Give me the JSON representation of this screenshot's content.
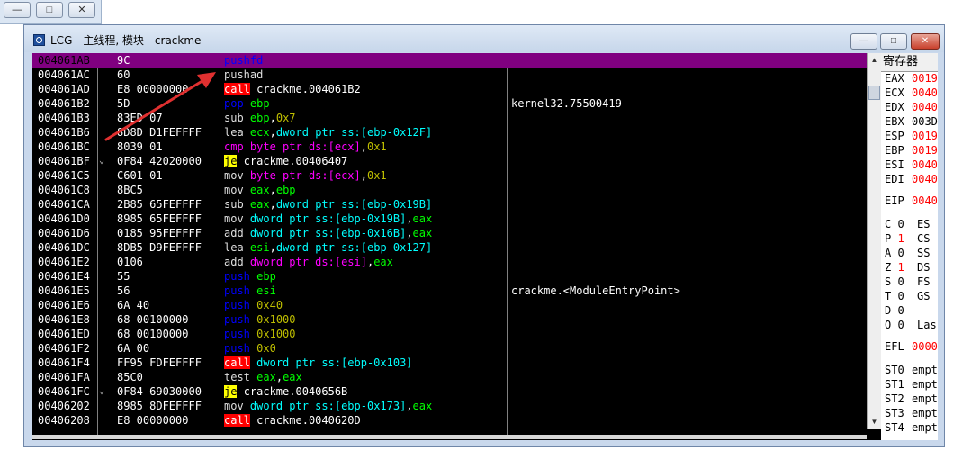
{
  "window": {
    "title": "LCG -  主线程, 模块 - crackme",
    "min_label": "—",
    "max_label": "□",
    "close_label": "✕"
  },
  "background_window": {
    "min_label": "—",
    "max_label": "□",
    "close_label": "✕"
  },
  "disassembly": {
    "selected_index": 0,
    "rows": [
      {
        "addr": "004061AB",
        "mark": "",
        "hex": "9C",
        "mn": "pushfd",
        "mc": "m-push",
        "ops": [],
        "com": ""
      },
      {
        "addr": "004061AC",
        "mark": "",
        "hex": "60",
        "mn": "pushad",
        "mc": "m-pushad",
        "ops": [],
        "com": ""
      },
      {
        "addr": "004061AD",
        "mark": "",
        "hex": "E8 00000000",
        "mn": "call",
        "mc": "m-call",
        "ops": [
          {
            "t": "crackme.004061B2",
            "c": "op-sym"
          }
        ],
        "com": ""
      },
      {
        "addr": "004061B2",
        "mark": "",
        "hex": "5D",
        "mn": "pop",
        "mc": "m-pop",
        "ops": [
          {
            "t": "ebp",
            "c": "op-reg"
          }
        ],
        "com": "kernel32.75500419"
      },
      {
        "addr": "004061B3",
        "mark": "",
        "hex": "83ED 07",
        "mn": "sub",
        "mc": "m-sub",
        "ops": [
          {
            "t": "ebp",
            "c": "op-reg"
          },
          {
            "t": ",",
            "c": "op-sym"
          },
          {
            "t": "0x7",
            "c": "op-num"
          }
        ],
        "com": ""
      },
      {
        "addr": "004061B6",
        "mark": "",
        "hex": "8D8D D1FEFFFF",
        "mn": "lea",
        "mc": "m-lea",
        "ops": [
          {
            "t": "ecx",
            "c": "op-reg"
          },
          {
            "t": ",",
            "c": "op-sym"
          },
          {
            "t": "dword ptr ss:[ebp-0x12F]",
            "c": "op-mem"
          }
        ],
        "com": ""
      },
      {
        "addr": "004061BC",
        "mark": "",
        "hex": "8039 01",
        "mn": "cmp",
        "mc": "m-cmp",
        "ops": [
          {
            "t": "byte ptr ds:[ecx]",
            "c": "op-kw"
          },
          {
            "t": ",",
            "c": "op-sym"
          },
          {
            "t": "0x1",
            "c": "op-num"
          }
        ],
        "com": ""
      },
      {
        "addr": "004061BF",
        "mark": "⌄",
        "hex": "0F84 42020000",
        "mn": "je",
        "mc": "m-jmp",
        "ops": [
          {
            "t": "crackme.00406407",
            "c": "op-sym"
          }
        ],
        "com": ""
      },
      {
        "addr": "004061C5",
        "mark": "",
        "hex": "C601 01",
        "mn": "mov",
        "mc": "m-mov",
        "ops": [
          {
            "t": "byte ptr ds:[ecx]",
            "c": "op-kw"
          },
          {
            "t": ",",
            "c": "op-sym"
          },
          {
            "t": "0x1",
            "c": "op-num"
          }
        ],
        "com": ""
      },
      {
        "addr": "004061C8",
        "mark": "",
        "hex": "8BC5",
        "mn": "mov",
        "mc": "m-mov",
        "ops": [
          {
            "t": "eax",
            "c": "op-reg"
          },
          {
            "t": ",",
            "c": "op-sym"
          },
          {
            "t": "ebp",
            "c": "op-reg"
          }
        ],
        "com": ""
      },
      {
        "addr": "004061CA",
        "mark": "",
        "hex": "2B85 65FEFFFF",
        "mn": "sub",
        "mc": "m-sub",
        "ops": [
          {
            "t": "eax",
            "c": "op-reg"
          },
          {
            "t": ",",
            "c": "op-sym"
          },
          {
            "t": "dword ptr ss:[ebp-0x19B]",
            "c": "op-mem"
          }
        ],
        "com": ""
      },
      {
        "addr": "004061D0",
        "mark": "",
        "hex": "8985 65FEFFFF",
        "mn": "mov",
        "mc": "m-mov",
        "ops": [
          {
            "t": "dword ptr ss:[ebp-0x19B]",
            "c": "op-mem"
          },
          {
            "t": ",",
            "c": "op-sym"
          },
          {
            "t": "eax",
            "c": "op-reg"
          }
        ],
        "com": ""
      },
      {
        "addr": "004061D6",
        "mark": "",
        "hex": "0185 95FEFFFF",
        "mn": "add",
        "mc": "m-add",
        "ops": [
          {
            "t": "dword ptr ss:[ebp-0x16B]",
            "c": "op-mem"
          },
          {
            "t": ",",
            "c": "op-sym"
          },
          {
            "t": "eax",
            "c": "op-reg"
          }
        ],
        "com": ""
      },
      {
        "addr": "004061DC",
        "mark": "",
        "hex": "8DB5 D9FEFFFF",
        "mn": "lea",
        "mc": "m-lea",
        "ops": [
          {
            "t": "esi",
            "c": "op-reg"
          },
          {
            "t": ",",
            "c": "op-sym"
          },
          {
            "t": "dword ptr ss:[ebp-0x127]",
            "c": "op-mem"
          }
        ],
        "com": ""
      },
      {
        "addr": "004061E2",
        "mark": "",
        "hex": "0106",
        "mn": "add",
        "mc": "m-add",
        "ops": [
          {
            "t": "dword ptr ds:[esi]",
            "c": "op-kw"
          },
          {
            "t": ",",
            "c": "op-sym"
          },
          {
            "t": "eax",
            "c": "op-reg"
          }
        ],
        "com": ""
      },
      {
        "addr": "004061E4",
        "mark": "",
        "hex": "55",
        "mn": "push",
        "mc": "m-push",
        "ops": [
          {
            "t": "ebp",
            "c": "op-reg"
          }
        ],
        "com": ""
      },
      {
        "addr": "004061E5",
        "mark": "",
        "hex": "56",
        "mn": "push",
        "mc": "m-push",
        "ops": [
          {
            "t": "esi",
            "c": "op-reg"
          }
        ],
        "com": "crackme.<ModuleEntryPoint>"
      },
      {
        "addr": "004061E6",
        "mark": "",
        "hex": "6A 40",
        "mn": "push",
        "mc": "m-push",
        "ops": [
          {
            "t": "0x40",
            "c": "op-num"
          }
        ],
        "com": ""
      },
      {
        "addr": "004061E8",
        "mark": "",
        "hex": "68 00100000",
        "mn": "push",
        "mc": "m-push",
        "ops": [
          {
            "t": "0x1000",
            "c": "op-num"
          }
        ],
        "com": ""
      },
      {
        "addr": "004061ED",
        "mark": "",
        "hex": "68 00100000",
        "mn": "push",
        "mc": "m-push",
        "ops": [
          {
            "t": "0x1000",
            "c": "op-num"
          }
        ],
        "com": ""
      },
      {
        "addr": "004061F2",
        "mark": "",
        "hex": "6A 00",
        "mn": "push",
        "mc": "m-push",
        "ops": [
          {
            "t": "0x0",
            "c": "op-num"
          }
        ],
        "com": ""
      },
      {
        "addr": "004061F4",
        "mark": "",
        "hex": "FF95 FDFEFFFF",
        "mn": "call",
        "mc": "m-call",
        "ops": [
          {
            "t": "dword ptr ss:[ebp-0x103]",
            "c": "op-mem"
          }
        ],
        "com": ""
      },
      {
        "addr": "004061FA",
        "mark": "",
        "hex": "85C0",
        "mn": "test",
        "mc": "m-test",
        "ops": [
          {
            "t": "eax",
            "c": "op-reg"
          },
          {
            "t": ",",
            "c": "op-sym"
          },
          {
            "t": "eax",
            "c": "op-reg"
          }
        ],
        "com": ""
      },
      {
        "addr": "004061FC",
        "mark": "⌄",
        "hex": "0F84 69030000",
        "mn": "je",
        "mc": "m-jmp",
        "ops": [
          {
            "t": "crackme.0040656B",
            "c": "op-sym"
          }
        ],
        "com": ""
      },
      {
        "addr": "00406202",
        "mark": "",
        "hex": "8985 8DFEFFFF",
        "mn": "mov",
        "mc": "m-mov",
        "ops": [
          {
            "t": "dword ptr ss:[ebp-0x173]",
            "c": "op-mem"
          },
          {
            "t": ",",
            "c": "op-sym"
          },
          {
            "t": "eax",
            "c": "op-reg"
          }
        ],
        "com": ""
      },
      {
        "addr": "00406208",
        "mark": "",
        "hex": "E8 00000000",
        "mn": "call",
        "mc": "m-call",
        "ops": [
          {
            "t": "crackme.0040620D",
            "c": "op-sym"
          }
        ],
        "com": ""
      }
    ]
  },
  "registers": {
    "header": "寄存器",
    "gp": [
      {
        "name": "EAX",
        "val": "0019"
      },
      {
        "name": "ECX",
        "val": "0040"
      },
      {
        "name": "EDX",
        "val": "0040"
      },
      {
        "name": "EBX",
        "val": "003D",
        "black": true
      },
      {
        "name": "ESP",
        "val": "0019"
      },
      {
        "name": "EBP",
        "val": "0019"
      },
      {
        "name": "ESI",
        "val": "0040"
      },
      {
        "name": "EDI",
        "val": "0040"
      }
    ],
    "eip": {
      "name": "EIP",
      "val": "0040"
    },
    "flags": [
      {
        "l": "C 0",
        "r": "ES"
      },
      {
        "l": "P 1",
        "r": "CS",
        "red": true
      },
      {
        "l": "A 0",
        "r": "SS"
      },
      {
        "l": "Z 1",
        "r": "DS",
        "red": true
      },
      {
        "l": "S 0",
        "r": "FS"
      },
      {
        "l": "T 0",
        "r": "GS"
      },
      {
        "l": "D 0",
        "r": ""
      },
      {
        "l": "O 0",
        "r": "Las"
      }
    ],
    "efl": {
      "name": "EFL",
      "val": "0000"
    },
    "fpu": [
      {
        "name": "ST0",
        "val": "empt"
      },
      {
        "name": "ST1",
        "val": "empt"
      },
      {
        "name": "ST2",
        "val": "empt"
      },
      {
        "name": "ST3",
        "val": "empt"
      },
      {
        "name": "ST4",
        "val": "empt"
      }
    ]
  },
  "colors": {
    "selection": "#800080",
    "arrow": "#e03030"
  }
}
